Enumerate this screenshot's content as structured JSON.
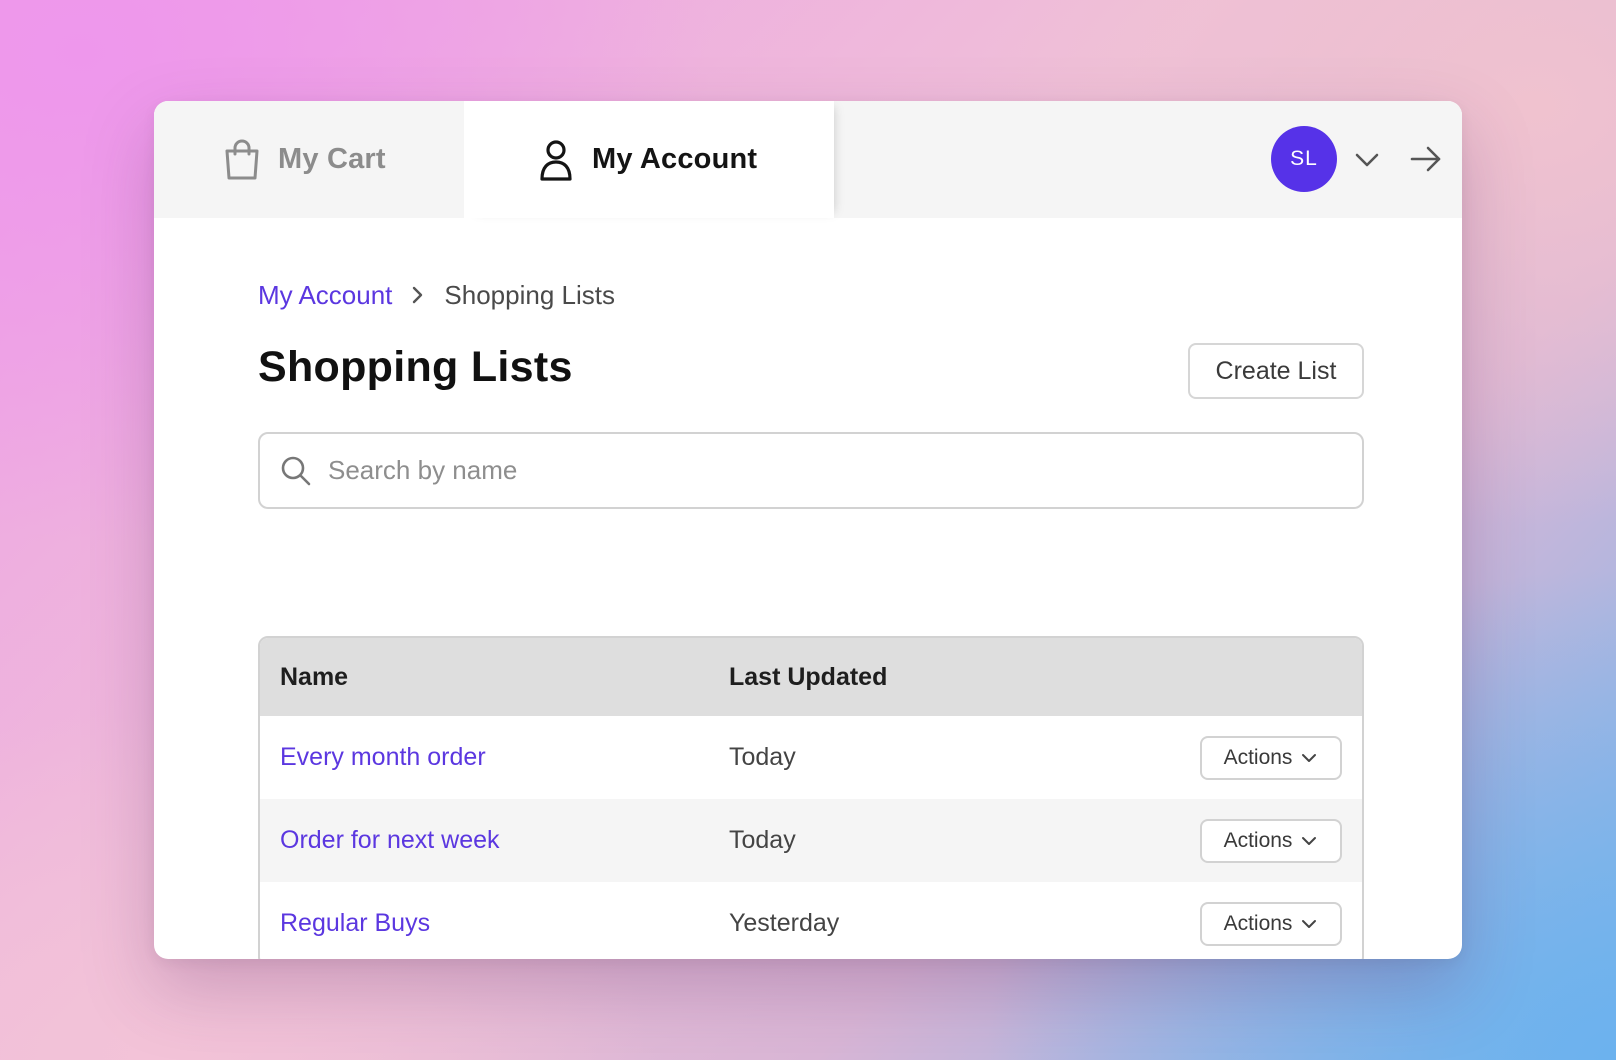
{
  "tabs": [
    {
      "label": "My Cart",
      "icon": "shopping-bag-icon"
    },
    {
      "label": "My Account",
      "icon": "user-icon",
      "active": true
    }
  ],
  "user": {
    "initials": "SL",
    "avatar_color": "#5632e8"
  },
  "breadcrumb": {
    "parent": "My Account",
    "current": "Shopping Lists"
  },
  "page": {
    "title": "Shopping Lists",
    "create_button": "Create List"
  },
  "search": {
    "placeholder": "Search by name",
    "value": ""
  },
  "table": {
    "columns": [
      "Name",
      "Last Updated"
    ],
    "rows": [
      {
        "name": "Every month order",
        "updated": "Today",
        "action": "Actions"
      },
      {
        "name": "Order for next week",
        "updated": "Today",
        "action": "Actions"
      },
      {
        "name": "Regular Buys",
        "updated": "Yesterday",
        "action": "Actions"
      }
    ]
  },
  "colors": {
    "accent": "#5b37e0",
    "avatar": "#5632e8",
    "header_bg": "#dedede"
  }
}
